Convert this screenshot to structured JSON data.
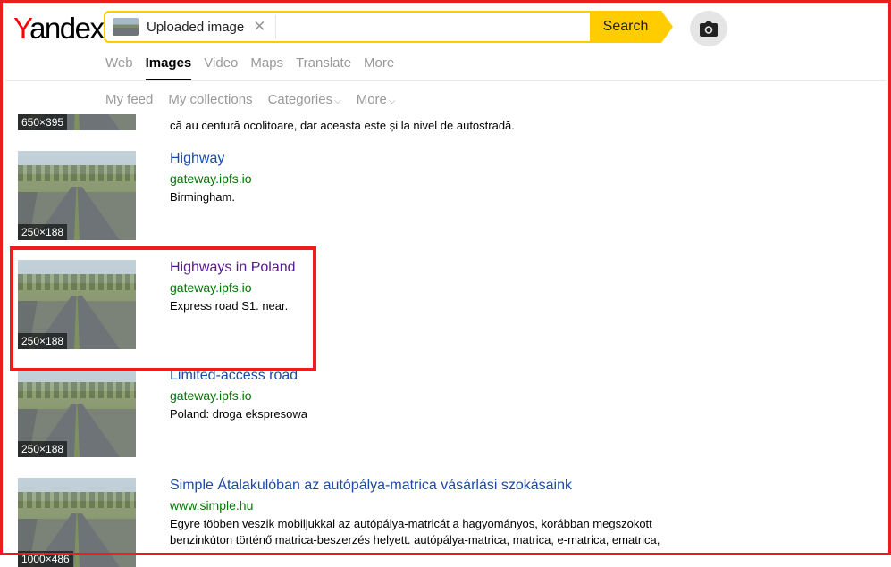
{
  "logo": {
    "first": "Y",
    "rest": "andex"
  },
  "search": {
    "chip_label": "Uploaded image",
    "clear_glyph": "✕",
    "button_label": "Search"
  },
  "tabs": [
    {
      "label": "Web",
      "active": false
    },
    {
      "label": "Images",
      "active": true
    },
    {
      "label": "Video",
      "active": false
    },
    {
      "label": "Maps",
      "active": false
    },
    {
      "label": "Translate",
      "active": false
    },
    {
      "label": "More",
      "active": false
    }
  ],
  "subnav": {
    "my_feed": "My feed",
    "my_collections": "My collections",
    "categories": "Categories",
    "more": "More"
  },
  "partial_result": {
    "size": "650×395",
    "desc": "că au centură ocolitoare, dar aceasta este și la nivel de autostradă."
  },
  "results": [
    {
      "title": "Highway",
      "url": "gateway.ipfs.io",
      "desc": "Birmingham.",
      "size": "250×188"
    },
    {
      "title": "Highways in Poland",
      "url": "gateway.ipfs.io",
      "desc": "Express road S1. near.",
      "size": "250×188"
    },
    {
      "title": "Limited-access road",
      "url": "gateway.ipfs.io",
      "desc": "Poland: droga ekspresowa",
      "size": "250×188"
    },
    {
      "title": "Simple Átalakulóban az autópálya-matrica vásárlási szokásaink",
      "url": "www.simple.hu",
      "desc": "Egyre többen veszik mobiljukkal az autópálya-matricát a hagyományos, korábban megszokott benzinkúton történő matrica-beszerzés helyett. autópálya-matrica, matrica, e-matrica, ematrica,",
      "size": "1000×486"
    }
  ],
  "colors": {
    "accent": "#ffcc00",
    "highlight": "#ee1c1c",
    "link": "#1a4aa8",
    "visited": "#551a8b",
    "url": "#007700"
  }
}
